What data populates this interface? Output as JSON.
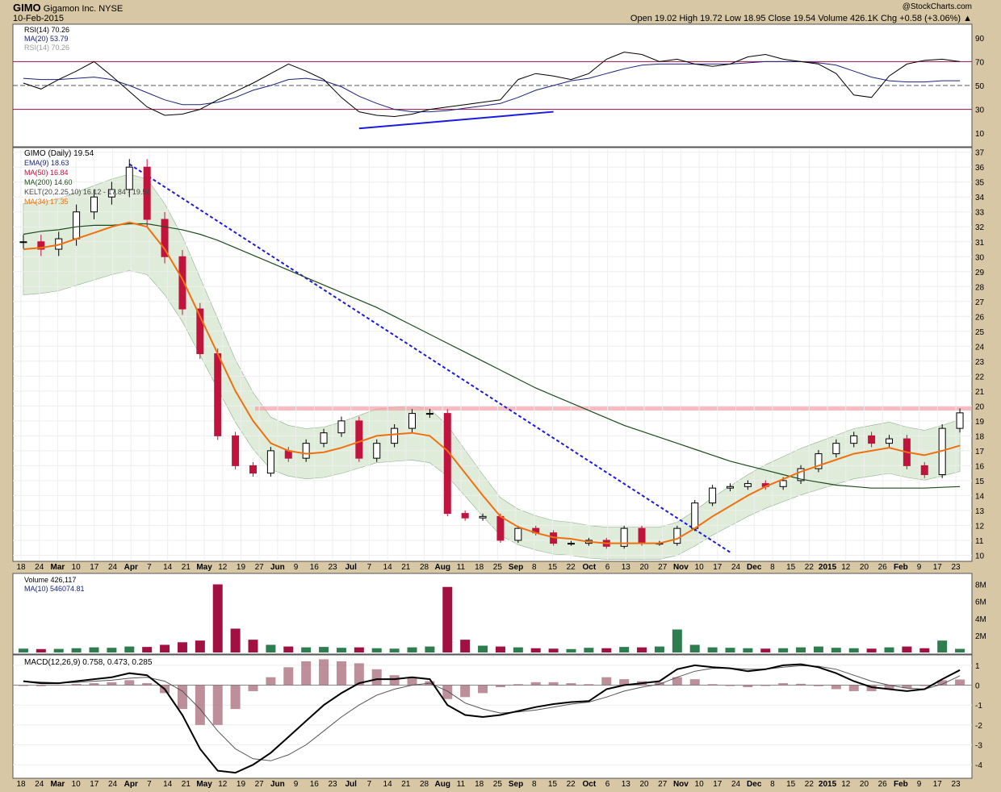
{
  "header": {
    "symbol": "GIMO",
    "company": "Gigamon Inc.",
    "exchange": "NYSE",
    "date": "10-Feb-2015",
    "watermark": "@StockCharts.com",
    "quote": "Open 19.02  High 19.72  Low 18.95  Close 19.54  Volume 426.1K  Chg +0.58 (+3.06%) ▲"
  },
  "colors": {
    "price_up": "#000000",
    "price_down": "#c0143c",
    "ema9": "#1a237e",
    "ma50": "#c0143c",
    "ma200": "#1b4d1b",
    "ma34": "#f07010",
    "kelt_fill": "#c9e0c0",
    "trendline": "#1a1ae0",
    "resistance": "#f4a0a8",
    "rsi_line": "#000000",
    "rsi_ma": "#1a237e",
    "volume_up": "#2e7d4f",
    "volume_down": "#a01040",
    "macd_hist": "#a06070"
  },
  "chart_data": [
    {
      "type": "line",
      "panel": "rsi",
      "legend": [
        "RSI(14) 70.26",
        "MA(20) 53.79",
        "RSI(14) 70.26"
      ],
      "ylim": [
        0,
        100
      ],
      "yticks": [
        10,
        30,
        50,
        70,
        90
      ],
      "reference_lines": [
        30,
        50,
        70
      ],
      "series": [
        {
          "name": "RSI(14)",
          "values": [
            52,
            47,
            55,
            62,
            70,
            58,
            45,
            32,
            25,
            26,
            30,
            38,
            45,
            52,
            60,
            68,
            62,
            55,
            40,
            28,
            25,
            24,
            26,
            30,
            32,
            34,
            36,
            38,
            55,
            60,
            58,
            55,
            60,
            72,
            78,
            76,
            70,
            72,
            68,
            66,
            68,
            74,
            76,
            72,
            70,
            68,
            60,
            42,
            40,
            58,
            68,
            71,
            72,
            70
          ]
        },
        {
          "name": "MA(20)",
          "values": [
            56,
            55,
            55,
            56,
            57,
            55,
            50,
            44,
            38,
            34,
            34,
            36,
            40,
            46,
            50,
            55,
            56,
            54,
            49,
            41,
            35,
            30,
            28,
            28,
            29,
            31,
            33,
            35,
            40,
            46,
            50,
            54,
            56,
            60,
            64,
            67,
            68,
            68,
            68,
            68,
            68,
            69,
            70,
            70,
            70,
            69,
            67,
            62,
            57,
            54,
            53,
            53,
            54,
            54
          ]
        }
      ]
    },
    {
      "type": "line",
      "panel": "price",
      "title": "GIMO (Daily) 19.54",
      "legend": [
        "EMA(9) 18.63",
        "MA(50) 16.84",
        "MA(200) 14.60",
        "KELT(20,2.25,10) 16.12 - 17.84 - 19.56",
        "MA(34) 17.35"
      ],
      "ylim": [
        9.7,
        37.2
      ],
      "yticks": [
        10,
        11,
        12,
        13,
        14,
        15,
        16,
        17,
        18,
        19,
        20,
        21,
        22,
        23,
        24,
        25,
        26,
        27,
        28,
        29,
        30,
        31,
        32,
        33,
        34,
        35,
        36,
        37
      ],
      "x_tick_labels": [
        "18",
        "24",
        "Mar",
        "10",
        "17",
        "24",
        "Apr",
        "7",
        "14",
        "21",
        "May",
        "12",
        "19",
        "27",
        "Jun",
        "9",
        "16",
        "23",
        "Jul",
        "7",
        "14",
        "21",
        "28",
        "Aug",
        "11",
        "18",
        "25",
        "Sep",
        "8",
        "15",
        "22",
        "Oct",
        "6",
        "13",
        "20",
        "27",
        "Nov",
        "10",
        "17",
        "24",
        "Dec",
        "8",
        "15",
        "22",
        "2015",
        "12",
        "20",
        "26",
        "Feb",
        "9",
        "17",
        "23"
      ],
      "resistance_level": 19.8,
      "series": [
        {
          "name": "Close",
          "values": [
            31.0,
            30.5,
            31.2,
            33.0,
            34.0,
            34.5,
            36.0,
            32.5,
            30.0,
            26.5,
            23.5,
            18.0,
            16.0,
            15.5,
            17.0,
            16.5,
            17.5,
            18.2,
            19.0,
            16.5,
            17.5,
            18.5,
            19.5,
            19.5,
            12.8,
            12.5,
            12.6,
            11.0,
            11.8,
            11.5,
            10.8,
            10.8,
            11.0,
            10.6,
            11.8,
            10.8,
            10.8,
            11.8,
            13.5,
            14.5,
            14.6,
            14.8,
            14.6,
            15.0,
            15.8,
            16.8,
            17.5,
            18.0,
            17.5,
            17.8,
            16.0,
            15.4,
            18.5,
            19.54
          ]
        },
        {
          "name": "MA(34)",
          "values": [
            30.5,
            30.6,
            30.8,
            31.2,
            31.6,
            32.0,
            32.3,
            32.0,
            30.5,
            28.5,
            26.0,
            23.5,
            21.0,
            19.0,
            17.5,
            17.0,
            16.8,
            16.9,
            17.2,
            17.6,
            18.0,
            18.1,
            18.2,
            18.0,
            17.0,
            15.5,
            14.0,
            12.6,
            11.9,
            11.5,
            11.2,
            11.1,
            10.9,
            10.8,
            10.8,
            10.8,
            10.8,
            11.1,
            11.8,
            12.6,
            13.3,
            14.0,
            14.6,
            15.1,
            15.6,
            16.0,
            16.4,
            16.8,
            17.0,
            17.2,
            16.9,
            16.7,
            17.0,
            17.35
          ]
        },
        {
          "name": "MA(200)",
          "values": [
            31.5,
            31.7,
            31.8,
            32.0,
            32.1,
            32.1,
            32.2,
            32.2,
            32.0,
            31.8,
            31.5,
            31.1,
            30.6,
            30.1,
            29.6,
            29.1,
            28.6,
            28.1,
            27.6,
            27.1,
            26.6,
            26.0,
            25.4,
            24.8,
            24.2,
            23.6,
            23.0,
            22.4,
            21.8,
            21.2,
            20.7,
            20.2,
            19.7,
            19.2,
            18.7,
            18.3,
            17.9,
            17.5,
            17.1,
            16.7,
            16.3,
            16.0,
            15.7,
            15.4,
            15.1,
            14.9,
            14.7,
            14.6,
            14.5,
            14.5,
            14.5,
            14.5,
            14.55,
            14.6
          ]
        }
      ]
    },
    {
      "type": "bar",
      "panel": "volume",
      "title": "Volume 426,117",
      "legend": [
        "MA(10) 546074.81"
      ],
      "ylim": [
        0,
        9000000
      ],
      "yticks_labels": [
        "2M",
        "4M",
        "6M",
        "8M"
      ],
      "yticks": [
        2000000,
        4000000,
        6000000,
        8000000
      ],
      "values": [
        450000,
        400000,
        420000,
        500000,
        600000,
        550000,
        700000,
        650000,
        900000,
        1200000,
        1400000,
        8000000,
        2800000,
        1500000,
        900000,
        700000,
        600000,
        650000,
        550000,
        600000,
        500000,
        450000,
        600000,
        700000,
        7700000,
        1500000,
        800000,
        700000,
        600000,
        500000,
        450000,
        400000,
        550000,
        500000,
        650000,
        600000,
        700000,
        2700000,
        900000,
        600000,
        550000,
        500000,
        450000,
        500000,
        600000,
        700000,
        550000,
        500000,
        450000,
        600000,
        700000,
        500000,
        1400000,
        426117
      ]
    },
    {
      "type": "line",
      "panel": "macd",
      "title": "MACD(12,26,9) 0.758, 0.473, 0.285",
      "ylim": [
        -4.6,
        1.4
      ],
      "yticks": [
        -4,
        -3,
        -2,
        -1,
        0,
        1
      ],
      "series": [
        {
          "name": "MACD",
          "values": [
            0.2,
            0.1,
            0.1,
            0.2,
            0.3,
            0.4,
            0.6,
            0.5,
            -0.2,
            -1.5,
            -3.2,
            -4.3,
            -4.4,
            -4.0,
            -3.4,
            -2.6,
            -1.8,
            -1.0,
            -0.4,
            0.1,
            0.3,
            0.3,
            0.4,
            0.3,
            -1.0,
            -1.5,
            -1.6,
            -1.5,
            -1.3,
            -1.1,
            -0.95,
            -0.85,
            -0.8,
            -0.2,
            0.0,
            0.1,
            0.2,
            0.8,
            1.0,
            0.9,
            0.85,
            0.7,
            0.8,
            1.0,
            1.05,
            0.9,
            0.6,
            0.2,
            -0.1,
            -0.2,
            -0.3,
            -0.2,
            0.3,
            0.758
          ]
        },
        {
          "name": "Signal",
          "values": [
            0.2,
            0.15,
            0.12,
            0.14,
            0.2,
            0.25,
            0.35,
            0.4,
            0.2,
            -0.3,
            -1.2,
            -2.3,
            -3.2,
            -3.7,
            -3.8,
            -3.5,
            -3.0,
            -2.3,
            -1.6,
            -1.0,
            -0.5,
            -0.2,
            0.0,
            0.1,
            -0.3,
            -0.9,
            -1.2,
            -1.4,
            -1.35,
            -1.25,
            -1.1,
            -0.95,
            -0.85,
            -0.6,
            -0.3,
            -0.1,
            0.05,
            0.4,
            0.7,
            0.85,
            0.85,
            0.8,
            0.8,
            0.9,
            0.98,
            0.95,
            0.8,
            0.5,
            0.2,
            0.0,
            -0.15,
            -0.2,
            0.05,
            0.473
          ]
        }
      ]
    }
  ]
}
